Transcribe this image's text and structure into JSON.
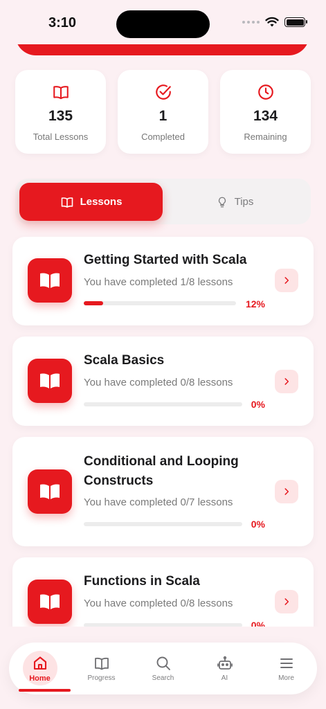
{
  "status": {
    "time": "3:10"
  },
  "stats": [
    {
      "value": "135",
      "label": "Total Lessons",
      "icon": "book-icon"
    },
    {
      "value": "1",
      "label": "Completed",
      "icon": "check-circle-icon"
    },
    {
      "value": "134",
      "label": "Remaining",
      "icon": "clock-icon"
    }
  ],
  "tabs": {
    "lessons": "Lessons",
    "tips": "Tips"
  },
  "lessons": [
    {
      "title": "Getting Started with Scala",
      "subtitle": "You have completed 1/8 lessons",
      "progress": 0.125,
      "percent": "12%"
    },
    {
      "title": "Scala Basics",
      "subtitle": "You have completed 0/8 lessons",
      "progress": 0,
      "percent": "0%"
    },
    {
      "title": "Conditional and Looping Constructs",
      "subtitle": "You have completed 0/7 lessons",
      "progress": 0,
      "percent": "0%"
    },
    {
      "title": "Functions in Scala",
      "subtitle": "You have completed 0/8 lessons",
      "progress": 0,
      "percent": "0%"
    }
  ],
  "nav": {
    "home": "Home",
    "progress": "Progress",
    "search": "Search",
    "ai": "AI",
    "more": "More"
  },
  "colors": {
    "accent": "#e6191f",
    "background": "#fcf0f3"
  }
}
